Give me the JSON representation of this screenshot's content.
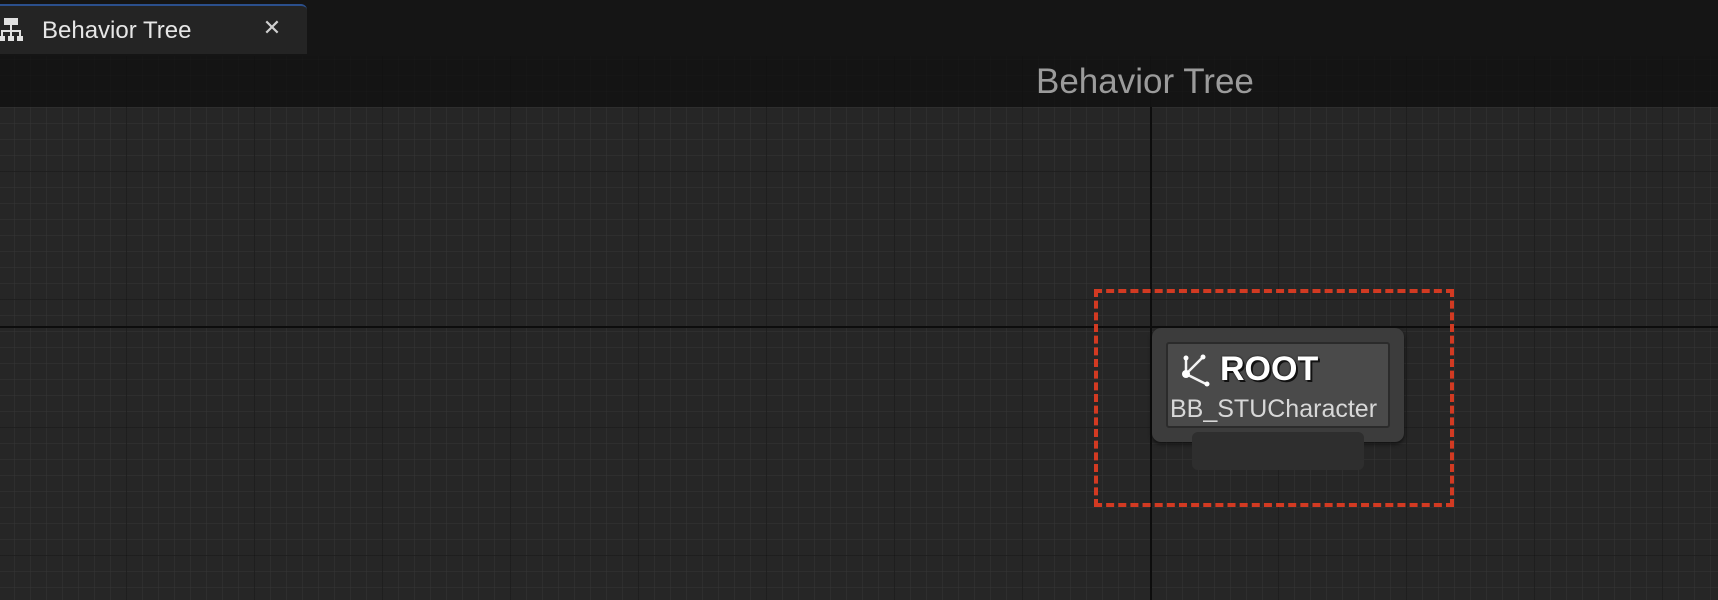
{
  "tabs": [
    {
      "label": "Behavior Tree",
      "icon": "behavior-tree-icon",
      "close_icon": "close-icon",
      "close_glyph": "✕",
      "active": true
    }
  ],
  "graph": {
    "title": "Behavior Tree",
    "nodes": [
      {
        "title": "ROOT",
        "subtitle": "BB_STUCharacter",
        "icon": "root-node-icon",
        "selected": true
      }
    ]
  },
  "colors": {
    "selection_border": "#d23a22",
    "tab_accent": "#2b4f8c",
    "graph_background": "#262626"
  }
}
